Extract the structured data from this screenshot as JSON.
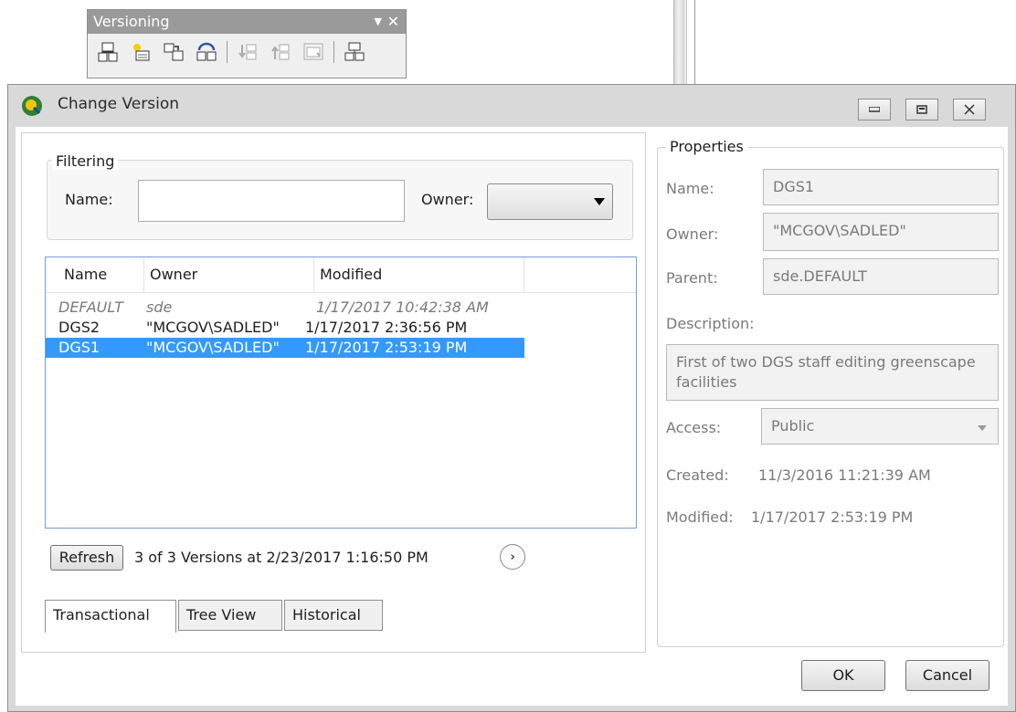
{
  "toolbar": {
    "title": "Versioning",
    "menu_glyph": "▼",
    "close_glyph": "✕"
  },
  "dialog": {
    "title": "Change Version",
    "minimize_glyph": "▭",
    "maximize_glyph": "▣",
    "close_glyph": "✕"
  },
  "filtering": {
    "legend": "Filtering",
    "name_label": "Name:",
    "name_value": "",
    "owner_label": "Owner:",
    "owner_value": ""
  },
  "version_list": {
    "columns": [
      "Name",
      "Owner",
      "Modified"
    ],
    "rows": [
      {
        "name": "DEFAULT",
        "owner": "sde",
        "modified": "1/17/2017 10:42:38 AM",
        "style": "italic"
      },
      {
        "name": "DGS2",
        "owner": "\"MCGOV\\SADLED\"",
        "modified": "1/17/2017 2:36:56 PM",
        "style": "normal"
      },
      {
        "name": "DGS1",
        "owner": "\"MCGOV\\SADLED\"",
        "modified": "1/17/2017 2:53:19 PM",
        "style": "selected"
      }
    ]
  },
  "footer": {
    "refresh_label": "Refresh",
    "status": "3 of 3 Versions at 2/23/2017 1:16:50 PM",
    "next_glyph": "›"
  },
  "tabs": [
    {
      "label": "Transactional",
      "active": true
    },
    {
      "label": "Tree View",
      "active": false
    },
    {
      "label": "Historical",
      "active": false
    }
  ],
  "properties": {
    "legend": "Properties",
    "name_label": "Name:",
    "name_value": "DGS1",
    "owner_label": "Owner:",
    "owner_value": "\"MCGOV\\SADLED\"",
    "parent_label": "Parent:",
    "parent_value": "sde.DEFAULT",
    "description_label": "Description:",
    "description_value": "First of two DGS staff editing greenscape facilities",
    "access_label": "Access:",
    "access_value": "Public",
    "created_label": "Created:",
    "created_value": "11/3/2016 11:21:39 AM",
    "modified_label": "Modified:",
    "modified_value": "1/17/2017 2:53:19 PM"
  },
  "buttons": {
    "ok": "OK",
    "cancel": "Cancel"
  },
  "colors": {
    "selection": "#3399ff",
    "list_border": "#7a9cd3"
  }
}
